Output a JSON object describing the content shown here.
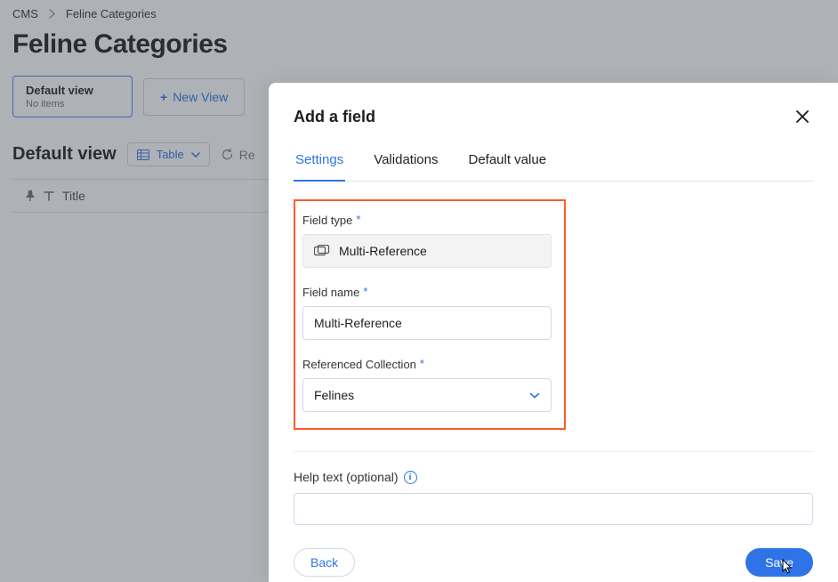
{
  "breadcrumb": {
    "root": "CMS",
    "current": "Feline Categories"
  },
  "page_title": "Feline Categories",
  "views": {
    "default_card": {
      "name": "Default view",
      "sub": "No items"
    },
    "new_view_label": "New View"
  },
  "toolbar": {
    "view_title": "Default view",
    "mode_label": "Table",
    "reset_label": "Re"
  },
  "grid": {
    "col_title": "Title"
  },
  "modal": {
    "title": "Add a field",
    "tabs": {
      "settings": "Settings",
      "validations": "Validations",
      "default": "Default value"
    },
    "labels": {
      "field_type": "Field type",
      "field_name": "Field name",
      "ref_collection": "Referenced Collection",
      "help_text": "Help text (optional)"
    },
    "values": {
      "field_type": "Multi-Reference",
      "field_name": "Multi-Reference",
      "ref_collection": "Felines",
      "help_text": ""
    },
    "buttons": {
      "back": "Back",
      "save": "Save"
    }
  }
}
